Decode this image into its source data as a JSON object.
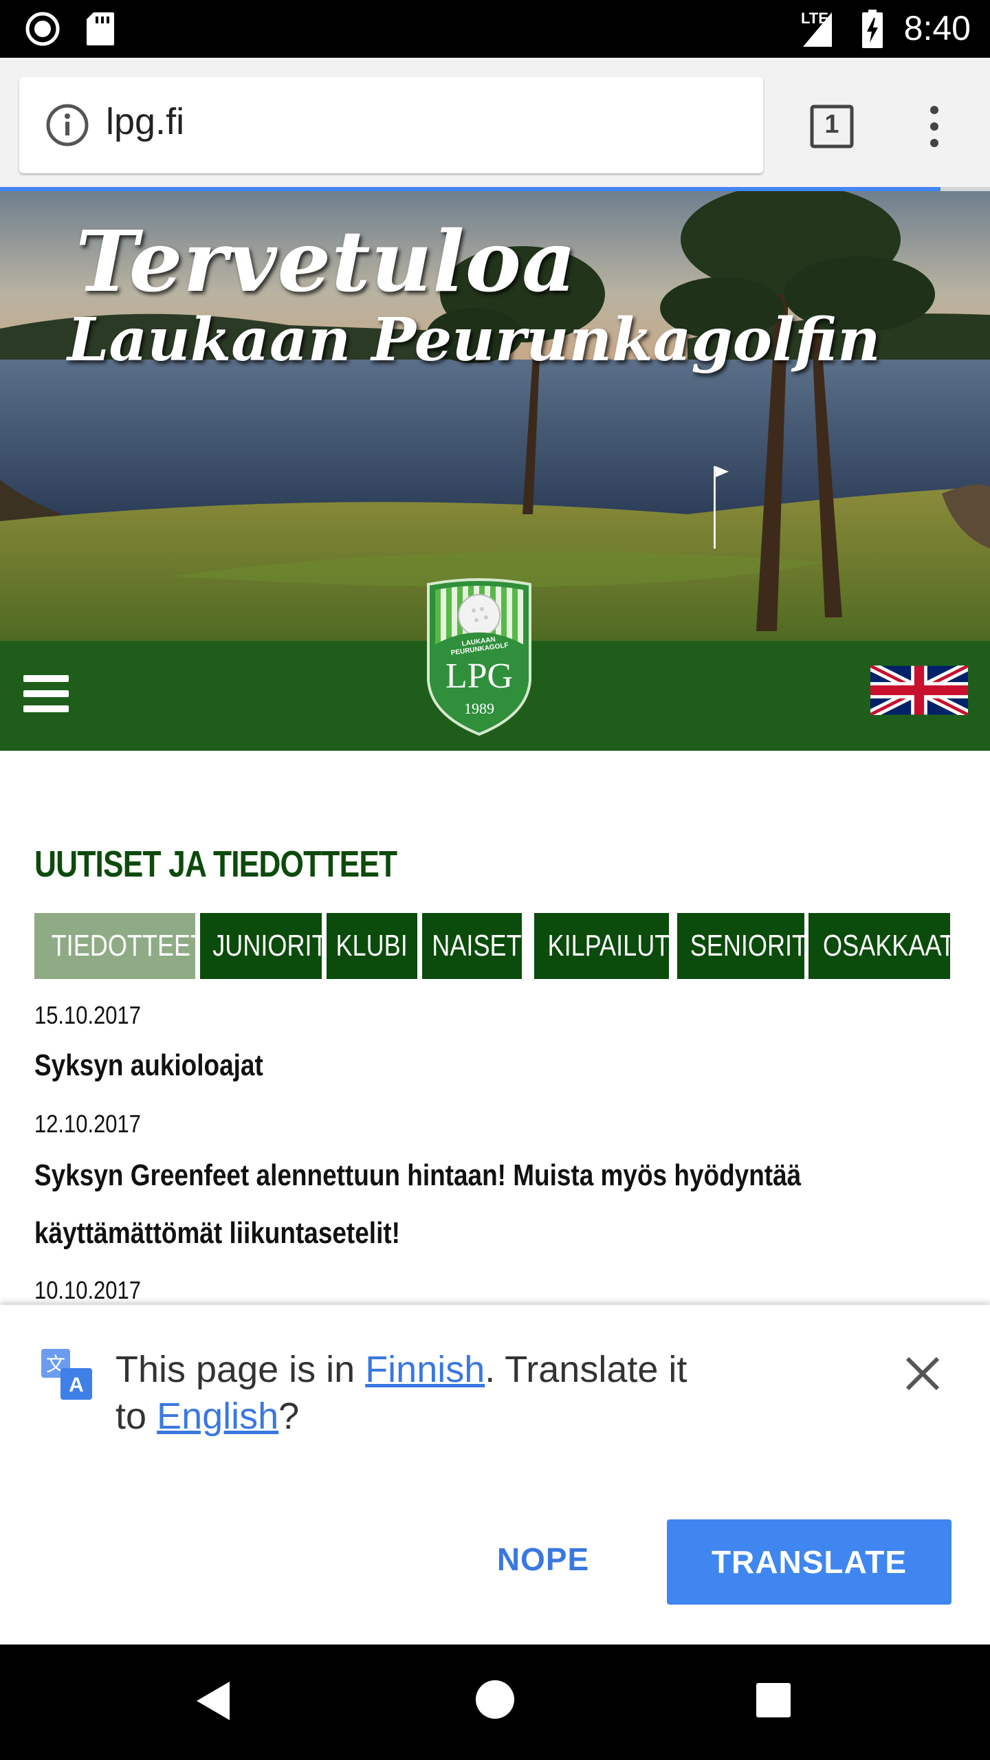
{
  "status_bar": {
    "time": "8:40",
    "network": "LTE",
    "icons": [
      "record-icon",
      "sd-card-icon",
      "signal-icon",
      "battery-charging-icon"
    ]
  },
  "browser": {
    "url": "lpg.fi",
    "tab_count": "1",
    "page_load_progress": 0.95,
    "icons": [
      "info-icon",
      "tab-switcher-icon",
      "more-vert-icon"
    ]
  },
  "hero": {
    "title": "Tervetuloa",
    "subtitle": "Laukaan Peurunkagolfin"
  },
  "header": {
    "logo_text": "LPG",
    "logo_ring_text": "LAUKAAN PEURUNKAGOLF",
    "logo_year": "1989",
    "icons": [
      "hamburger-menu-icon",
      "uk-flag-icon"
    ]
  },
  "news": {
    "section_title": "UUTISET JA TIEDOTTEET",
    "tabs": [
      {
        "label": "TIEDOTTEET",
        "active": true
      },
      {
        "label": "JUNIORIT",
        "active": false
      },
      {
        "label": "KLUBI",
        "active": false
      },
      {
        "label": "NAISET",
        "active": false
      },
      {
        "label": "KILPAILUT",
        "active": false
      },
      {
        "label": "SENIORIT",
        "active": false
      },
      {
        "label": "OSAKKAAT",
        "active": false
      }
    ],
    "items": [
      {
        "date": "15.10.2017",
        "title": "Syksyn aukioloajat"
      },
      {
        "date": "12.10.2017",
        "title": "Syksyn Greenfeet alennettuun hintaan! Muista myös hyödyntää käyttämättömät liikuntasetelit!"
      },
      {
        "date": "10.10.2017",
        "title": ""
      }
    ]
  },
  "translate_prompt": {
    "text_before": "This page is in ",
    "source_language": "Finnish",
    "text_middle": ". Translate it to ",
    "target_language": "English",
    "text_after": "?",
    "nope_label": "NOPE",
    "translate_label": "TRANSLATE",
    "icons": [
      "translate-icon",
      "close-icon"
    ]
  },
  "nav_bar": {
    "icons": [
      "back-icon",
      "home-icon",
      "recents-icon"
    ]
  },
  "colors": {
    "brand_green": "#1e5e1a",
    "tab_dark_green": "#0b4b0b",
    "tab_active": "#8eab85",
    "title_green": "#0d4a0d",
    "link_blue": "#3a78e0",
    "button_blue": "#3f86f0"
  }
}
